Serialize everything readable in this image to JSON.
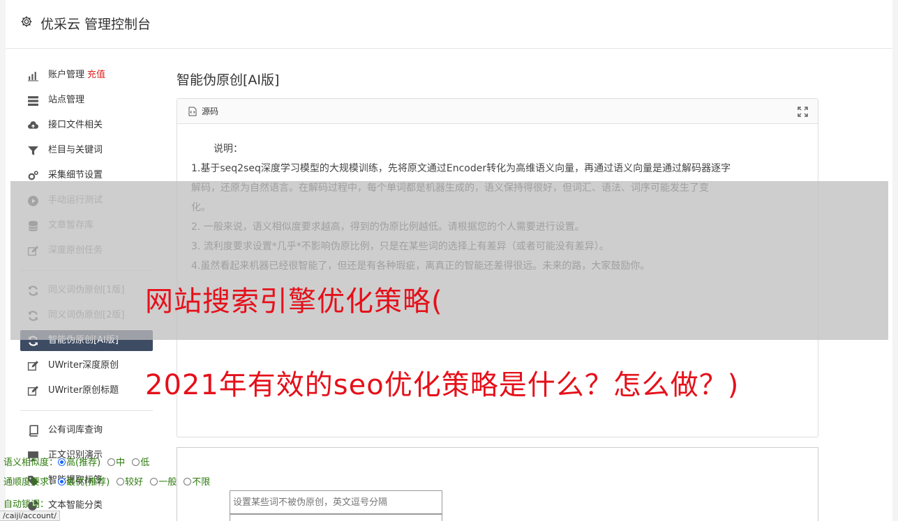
{
  "header": {
    "title": "优采云 管理控制台"
  },
  "sidebar": {
    "group1": [
      {
        "label": "账户管理",
        "extra": "充值",
        "icon": "bar-chart-icon"
      },
      {
        "label": "站点管理",
        "icon": "server-icon"
      },
      {
        "label": "接口文件相关",
        "icon": "cloud-upload-icon"
      },
      {
        "label": "栏目与关键词",
        "icon": "filter-icon"
      },
      {
        "label": "采集细节设置",
        "icon": "gears-icon"
      },
      {
        "label": "手动运行测试",
        "icon": "play-circle-icon"
      },
      {
        "label": "文章暂存库",
        "icon": "database-icon"
      },
      {
        "label": "深度原创任务",
        "icon": "edit-icon"
      }
    ],
    "group2": [
      {
        "label": "同义词伪原创[1版]",
        "icon": "refresh-icon"
      },
      {
        "label": "同义词伪原创[2版]",
        "icon": "refresh-icon"
      },
      {
        "label": "智能伪原创[AI版]",
        "icon": "refresh-icon",
        "active": true
      },
      {
        "label": "UWriter深度原创",
        "icon": "edit-icon"
      },
      {
        "label": "UWriter原创标题",
        "icon": "edit-icon"
      }
    ],
    "group3": [
      {
        "label": "公有词库查询",
        "icon": "book-icon"
      },
      {
        "label": "正文识别演示",
        "icon": "monitor-icon"
      },
      {
        "label": "智能提取标签",
        "icon": "tag-icon"
      },
      {
        "label": "文本智能分类",
        "icon": "pie-chart-icon"
      }
    ]
  },
  "main": {
    "title": "智能伪原创[AI版]",
    "editor": {
      "source_label": "源码",
      "lines": [
        "说明：",
        "1.基于seq2seq深度学习模型的大规模训练，先将原文通过Encoder转化为高维语义向量，再通过语义向量是通过解码器逐字",
        "解码，还原为自然语言。在解码过程中，每个单词都是机器生成的，语义保持得很好，但词汇、语法、词序可能发生了变",
        "化。",
        "2. 一般来说，语义相似度要求越高，得到的伪原比例越低。请根据您的个人需要进行设置。",
        "3. 流利度要求设置*几乎*不影响伪原比例，只是在某些词的选择上有差异（或者可能没有差异）。",
        "4.虽然看起来机器已经很智能了，但还是有各种瑕疵，离真正的智能还差得很远。未来的路，大家鼓励你。"
      ]
    },
    "options": {
      "similarity_label": "语义相似度：",
      "similarity": [
        {
          "label": "高(推荐)",
          "checked": true
        },
        {
          "label": "中",
          "checked": false
        },
        {
          "label": "低",
          "checked": false
        }
      ],
      "fluency_label": "通顺度要求：",
      "fluency": [
        {
          "label": "最优(推荐)",
          "checked": true
        },
        {
          "label": "较好",
          "checked": false
        },
        {
          "label": "一般",
          "checked": false
        },
        {
          "label": "不限",
          "checked": false
        }
      ],
      "lock_label": "自动锁词：",
      "lock_placeholder": "设置某些词不被伪原创，英文逗号分隔"
    }
  },
  "overlay": {
    "headline_line1": "网站搜索引擎优化策略(",
    "headline_line2": "2021年有效的seo优化策略是什么？怎么做？)"
  },
  "statusbar": {
    "url": "/caiji/account/"
  },
  "colors": {
    "accent_red": "#e5101a",
    "active_nav": "#3d4b63",
    "option_green": "#2b7a0b"
  }
}
